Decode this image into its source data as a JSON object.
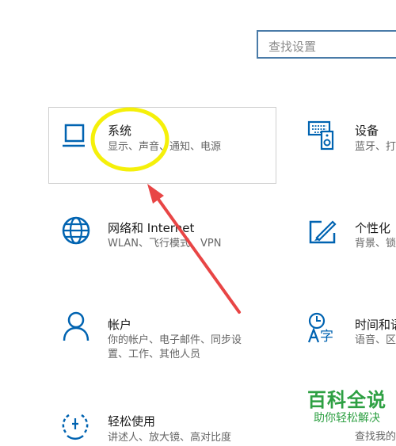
{
  "search": {
    "placeholder": "查找设置"
  },
  "tiles": {
    "system": {
      "title": "系统",
      "desc": "显示、声音、通知、电源"
    },
    "devices": {
      "title": "设备",
      "desc": "蓝牙、打"
    },
    "network": {
      "title": "网络和 Internet",
      "desc": "WLAN、飞行模式、VPN"
    },
    "personalization": {
      "title": "个性化",
      "desc": "背景、锁"
    },
    "accounts": {
      "title": "帐户",
      "desc_line1": "你的帐户、电子邮件、同步设",
      "desc_line2": "置、工作、其他人员"
    },
    "time_language": {
      "title": "时间和语",
      "desc": "语音、区"
    },
    "ease_of_access": {
      "title": "轻松使用",
      "desc": "讲述人、放大镜、高对比度"
    },
    "search_tile": {
      "desc": "查找我的"
    }
  },
  "watermark": {
    "title": "百科全说",
    "subtitle": "助你轻松解决"
  },
  "colors": {
    "accent": "#0063b1",
    "highlight_circle": "#f5f00a",
    "arrow": "#e84545",
    "watermark": "#2ea043"
  }
}
